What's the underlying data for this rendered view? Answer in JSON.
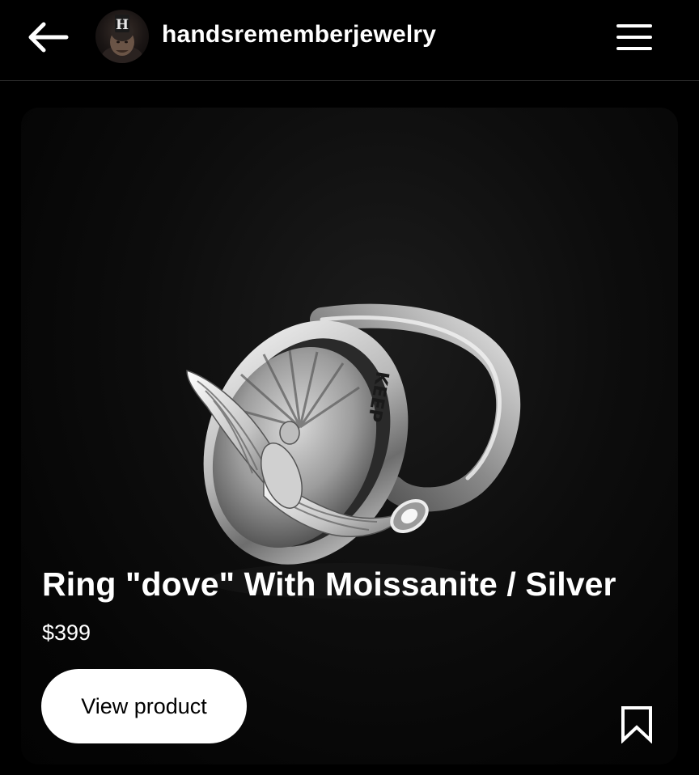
{
  "header": {
    "back_icon": "arrow-left-icon",
    "avatar_icon": "profile-avatar",
    "username": "handsrememberjewelry",
    "menu_icon": "hamburger-menu-icon"
  },
  "product": {
    "image_description_icon": "silver-dove-ring-image",
    "image_ring_text": "KEEP",
    "title": "Ring \"dove\" With Moissanite / Silver",
    "price": "$399",
    "view_label": "View product",
    "save_icon": "bookmark-icon"
  },
  "colors": {
    "background": "#000000",
    "text": "#ffffff",
    "button_bg": "#ffffff",
    "button_text": "#000000",
    "divider": "#262626"
  }
}
